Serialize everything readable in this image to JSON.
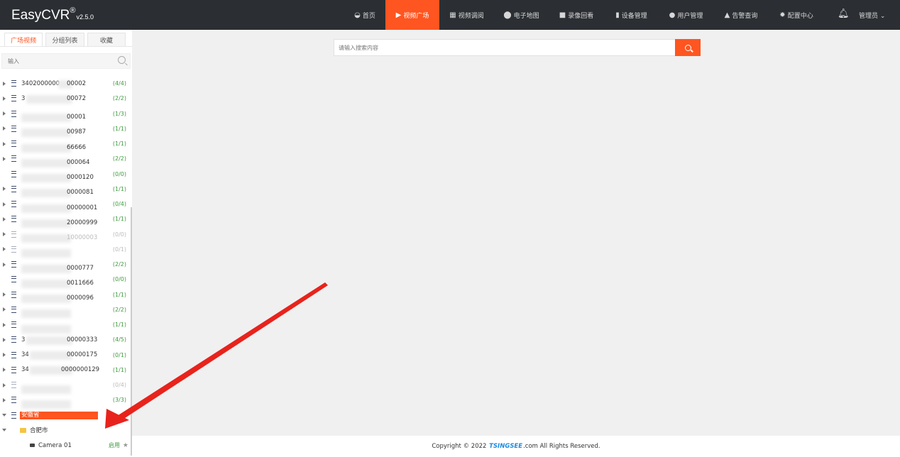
{
  "app": {
    "name": "EasyCVR",
    "reg": "®",
    "version": "v2.5.0"
  },
  "nav": {
    "items": [
      {
        "label": "首页",
        "icon": "dashboard-icon"
      },
      {
        "label": "视频广场",
        "icon": "play-circle-icon",
        "active": true
      },
      {
        "label": "视频调阅",
        "icon": "grid-view-icon"
      },
      {
        "label": "电子地图",
        "icon": "map-pin-icon"
      },
      {
        "label": "录像回看",
        "icon": "video-camera-icon"
      },
      {
        "label": "设备管理",
        "icon": "device-icon"
      },
      {
        "label": "用户管理",
        "icon": "user-icon"
      },
      {
        "label": "告警查询",
        "icon": "alarm-icon"
      },
      {
        "label": "配置中心",
        "icon": "gear-icon"
      }
    ],
    "user_label": "管理员 ⌄"
  },
  "sidebar": {
    "tabs": [
      "广场视频",
      "分组列表",
      "收藏"
    ],
    "search_placeholder": "输入",
    "devices": [
      {
        "label": "3402000000",
        "suffix": "00002",
        "count": "(4/4)"
      },
      {
        "label": "3",
        "suffix": "00072",
        "count": "(2/2)"
      },
      {
        "label": "",
        "suffix": "00001",
        "count": "(1/3)"
      },
      {
        "label": "",
        "suffix": "00987",
        "count": "(1/1)"
      },
      {
        "label": "",
        "suffix": "66666",
        "count": "(1/1)"
      },
      {
        "label": "",
        "suffix": "000064",
        "count": "(2/2)"
      },
      {
        "label": "",
        "suffix": "0000120",
        "count": "(0/0)"
      },
      {
        "label": "",
        "suffix": "0000081",
        "count": "(1/1)"
      },
      {
        "label": "",
        "suffix": "00000001",
        "count": "(0/4)"
      },
      {
        "label": "",
        "suffix": "20000999",
        "count": "(1/1)"
      },
      {
        "label": "",
        "suffix": "10000003",
        "count": "(0/0)"
      },
      {
        "label": "",
        "suffix": "",
        "count": "(0/1)"
      },
      {
        "label": "",
        "suffix": "0000777",
        "count": "(2/2)"
      },
      {
        "label": "",
        "suffix": "0011666",
        "count": "(0/0)"
      },
      {
        "label": "",
        "suffix": "0000096",
        "count": "(1/1)"
      },
      {
        "label": "",
        "suffix": "",
        "count": "(2/2)"
      },
      {
        "label": "",
        "suffix": "",
        "count": "(1/1)"
      },
      {
        "label": "3",
        "suffix": "00000333",
        "count": "(4/5)"
      },
      {
        "label": "34",
        "suffix": "00000175",
        "count": "(0/1)"
      },
      {
        "label": "34",
        "suffix": "0000000129",
        "count": "(1/1)"
      },
      {
        "label": "",
        "suffix": "",
        "count": "(0/4)"
      },
      {
        "label": "",
        "suffix": "",
        "count": "(3/3)"
      }
    ],
    "selected_node": "安徽省",
    "city_node": "合肥市",
    "camera": {
      "name": "Camera 01",
      "status": "启用"
    }
  },
  "main": {
    "search_placeholder": "请输入搜索内容"
  },
  "footer": {
    "prefix": "Copyright © 2022",
    "brand": "TSINGSEE",
    "suffix": ".com All Rights Reserved."
  },
  "colors": {
    "accent": "#ff5520",
    "topbar": "#2b2f33",
    "count_green": "#3d9a3d",
    "annotation_red": "#e8231c"
  }
}
